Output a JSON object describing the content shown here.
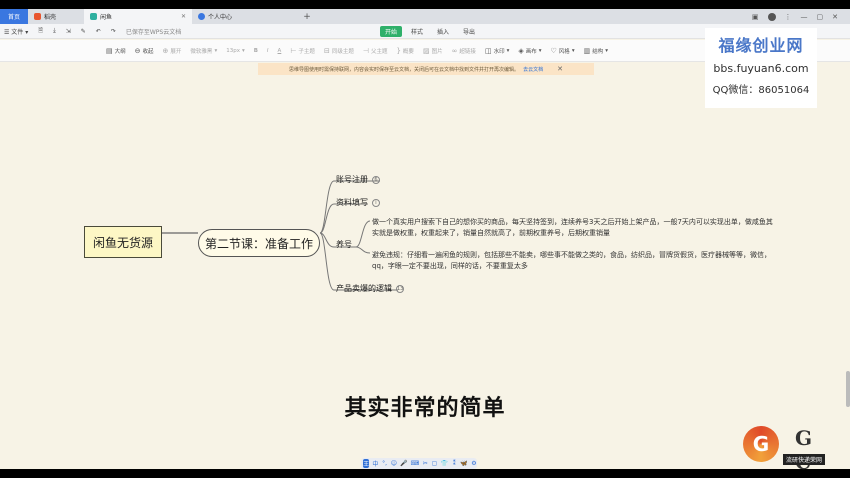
{
  "tabs": [
    {
      "label": "首页",
      "kind": "home"
    },
    {
      "label": "稻壳",
      "kind": "normal",
      "icon_color": "#e8552e"
    },
    {
      "label": "闲鱼",
      "kind": "active",
      "icon_color": "#2fb0a0"
    },
    {
      "label": "个人中心",
      "kind": "normal",
      "icon_color": "#3a77e0"
    }
  ],
  "new_tab": "+",
  "menu": {
    "file": "文件",
    "saved_status": "已保存至WPS云文档",
    "tabs": [
      "开始",
      "样式",
      "插入",
      "导出"
    ],
    "active_tab": "开始"
  },
  "toolbar": [
    {
      "icon": "outline-icon",
      "label": "大纲",
      "dim": false
    },
    {
      "icon": "collect-icon",
      "label": "收起",
      "dim": false
    },
    {
      "icon": "expand-icon",
      "label": "展开",
      "dim": true
    },
    {
      "icon": "font-icon",
      "label": "微软雅黑",
      "dim": true
    },
    {
      "icon": "size-icon",
      "label": "13px",
      "dim": true
    },
    {
      "icon": "bold-icon",
      "label": "B",
      "dim": true
    },
    {
      "icon": "italic-icon",
      "label": "I",
      "dim": true
    },
    {
      "icon": "color-icon",
      "label": "A",
      "dim": true
    },
    {
      "icon": "sub-topic-icon",
      "label": "子主题",
      "dim": true
    },
    {
      "icon": "sibling-topic-icon",
      "label": "同级主题",
      "dim": true
    },
    {
      "icon": "parent-topic-icon",
      "label": "父主题",
      "dim": true
    },
    {
      "icon": "summary-icon",
      "label": "概要",
      "dim": true
    },
    {
      "icon": "image-icon",
      "label": "图片",
      "dim": true
    },
    {
      "icon": "hyperlink-icon",
      "label": "超链接",
      "dim": true
    },
    {
      "icon": "watermark-icon",
      "label": "水印",
      "dim": false
    },
    {
      "icon": "canvas-icon",
      "label": "画布",
      "dim": false
    },
    {
      "icon": "style-icon",
      "label": "风格",
      "dim": false
    },
    {
      "icon": "structure-icon",
      "label": "结构",
      "dim": false
    }
  ],
  "notice": {
    "text": "思维导图使用时需保持联网，内容会实时保存至云文档，关闭后可在云文档中找到文件并打开再次编辑。",
    "link": "去云文档"
  },
  "watermark": {
    "title": "福缘创业网",
    "url": "bbs.fuyuan6.com",
    "contact": "QQ微信：86051064"
  },
  "mindmap": {
    "root": "闲鱼无货源",
    "sub": "第二节课：准备工作",
    "branches": [
      {
        "label": "账号注册",
        "badge": "6"
      },
      {
        "label": "资料填写",
        "badge": "i"
      },
      {
        "label": "养号",
        "badge": ""
      },
      {
        "label": "产品卖爆的逻辑",
        "badge": "13"
      }
    ],
    "paragraphs": [
      "做一个真实用户搜索下自己的想你买的商品，每天坚持签到，连续养号3天之后开始上架产品，一般7天内可以实现出单，做咸鱼其实就是做权重，权重起来了，销量自然就高了，前期权重养号，后期权重销量",
      "避免违规：仔细看一遍闲鱼的规则，包括那些不能卖，哪些事不能做之类的，食品，纺织品，冒牌货假货，医疗器械等等，微信，qq，字眼一定不要出现，同样的话，不要重复太多"
    ]
  },
  "subtitle": "其实非常的简单",
  "bottombar": [
    "王",
    "中",
    "°,",
    "☺",
    "🎤",
    "⌨",
    "✂",
    "▢",
    "👕",
    "⁑",
    "🦋",
    "⚙"
  ],
  "logo": {
    "letters": "G C",
    "tagline": "流研快递荣网"
  },
  "colors": {
    "accent_green": "#2fb06a",
    "home_tab": "#3a77e0",
    "canvas_bg": "#f7f3e6",
    "root_fill": "#fdf7c5"
  }
}
